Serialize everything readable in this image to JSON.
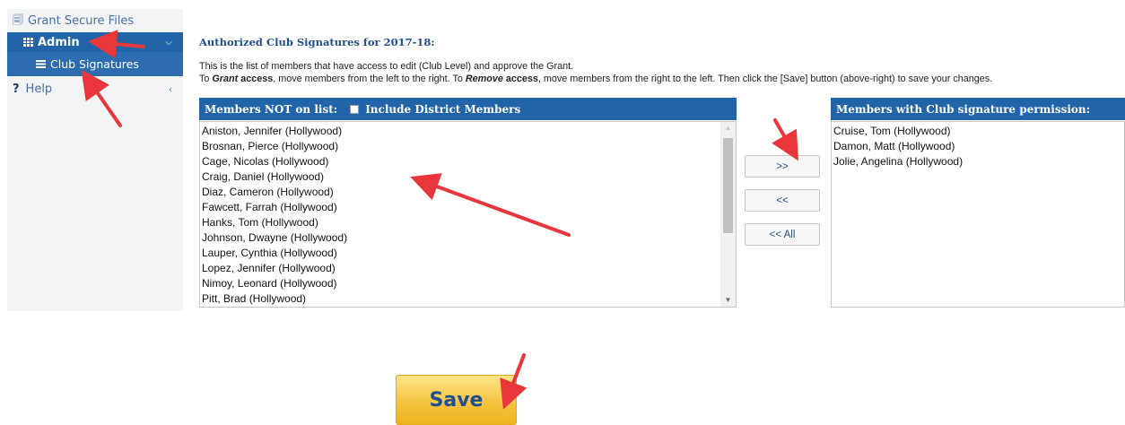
{
  "sidebar": {
    "grant_secure_files": "Grant Secure Files",
    "admin": "Admin",
    "club_signatures": "Club Signatures",
    "help_icon": "?",
    "help": "Help"
  },
  "main": {
    "heading": "Authorized Club Signatures for 2017-18:",
    "desc_line1": "This is the list of members that have access to edit (Club Level) and approve the Grant.",
    "desc_to1": "To ",
    "desc_grant": "Grant",
    "desc_access1": " access",
    "desc_mid1": ", move members from the left to the right. To ",
    "desc_remove": "Remove",
    "desc_access2": " access",
    "desc_mid2": ", move members from the right to the left. Then click the [Save] button (above-right) to save your changes.",
    "left_header": "Members NOT on list:",
    "include_district": "Include District Members",
    "right_header": "Members with Club signature permission:",
    "not_on_list": [
      "Aniston, Jennifer (Hollywood)",
      "Brosnan, Pierce (Hollywood)",
      "Cage, Nicolas (Hollywood)",
      "Craig, Daniel (Hollywood)",
      "Diaz, Cameron (Hollywood)",
      "Fawcett, Farrah (Hollywood)",
      "Hanks, Tom (Hollywood)",
      "Johnson, Dwayne (Hollywood)",
      "Lauper, Cynthia (Hollywood)",
      "Lopez, Jennifer (Hollywood)",
      "Nimoy, Leonard (Hollywood)",
      "Pitt, Brad (Hollywood)"
    ],
    "with_permission": [
      "Cruise, Tom (Hollywood)",
      "Damon, Matt (Hollywood)",
      "Jolie, Angelina (Hollywood)"
    ],
    "btn_move_right": ">>",
    "btn_move_left": "<<",
    "btn_move_all_left": "<< All",
    "save": "Save"
  },
  "colors": {
    "primary_blue": "#2264a8",
    "accent_maroon": "#8a1c3a",
    "annotation_red": "#e8363a",
    "save_yellow": "#f5c23b"
  }
}
